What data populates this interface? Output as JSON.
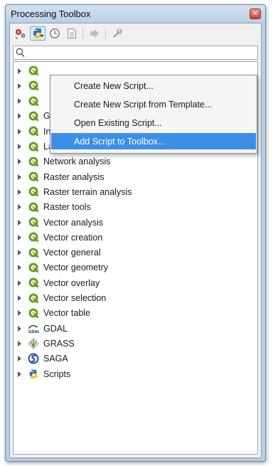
{
  "window": {
    "title": "Processing Toolbox",
    "close_glyph": "✕"
  },
  "toolbar": {
    "buttons": [
      {
        "icon": "models-icon"
      },
      {
        "icon": "python-scripts-icon",
        "pressed": true
      },
      {
        "icon": "history-icon"
      },
      {
        "icon": "results-icon"
      },
      {
        "icon": "edit-features-in-place-icon"
      },
      {
        "icon": "options-icon"
      }
    ]
  },
  "search": {
    "value": "",
    "placeholder": ""
  },
  "menu": {
    "items": [
      {
        "label": "Create New Script..."
      },
      {
        "label": "Create New Script from Template..."
      },
      {
        "label": "Open Existing Script..."
      },
      {
        "label": "Add Script to Toolbox...",
        "highlighted": true
      }
    ],
    "highlight_color": "#3d8ee6"
  },
  "tree": {
    "items": [
      {
        "label": "",
        "icon": "qgis-icon"
      },
      {
        "label": "",
        "icon": "qgis-icon"
      },
      {
        "label": "",
        "icon": "qgis-icon"
      },
      {
        "label": "Graphics",
        "icon": "qgis-icon"
      },
      {
        "label": "Interpolation",
        "icon": "qgis-icon"
      },
      {
        "label": "Layer tools",
        "icon": "qgis-icon"
      },
      {
        "label": "Network analysis",
        "icon": "qgis-icon"
      },
      {
        "label": "Raster analysis",
        "icon": "qgis-icon"
      },
      {
        "label": "Raster terrain analysis",
        "icon": "qgis-icon"
      },
      {
        "label": "Raster tools",
        "icon": "qgis-icon"
      },
      {
        "label": "Vector analysis",
        "icon": "qgis-icon"
      },
      {
        "label": "Vector creation",
        "icon": "qgis-icon"
      },
      {
        "label": "Vector general",
        "icon": "qgis-icon"
      },
      {
        "label": "Vector geometry",
        "icon": "qgis-icon"
      },
      {
        "label": "Vector overlay",
        "icon": "qgis-icon"
      },
      {
        "label": "Vector selection",
        "icon": "qgis-icon"
      },
      {
        "label": "Vector table",
        "icon": "qgis-icon"
      },
      {
        "label": "GDAL",
        "icon": "gdal-icon"
      },
      {
        "label": "GRASS",
        "icon": "grass-icon"
      },
      {
        "label": "SAGA",
        "icon": "saga-icon"
      },
      {
        "label": "Scripts",
        "icon": "python-icon"
      }
    ],
    "qgis_green": "#5e9e2e"
  }
}
